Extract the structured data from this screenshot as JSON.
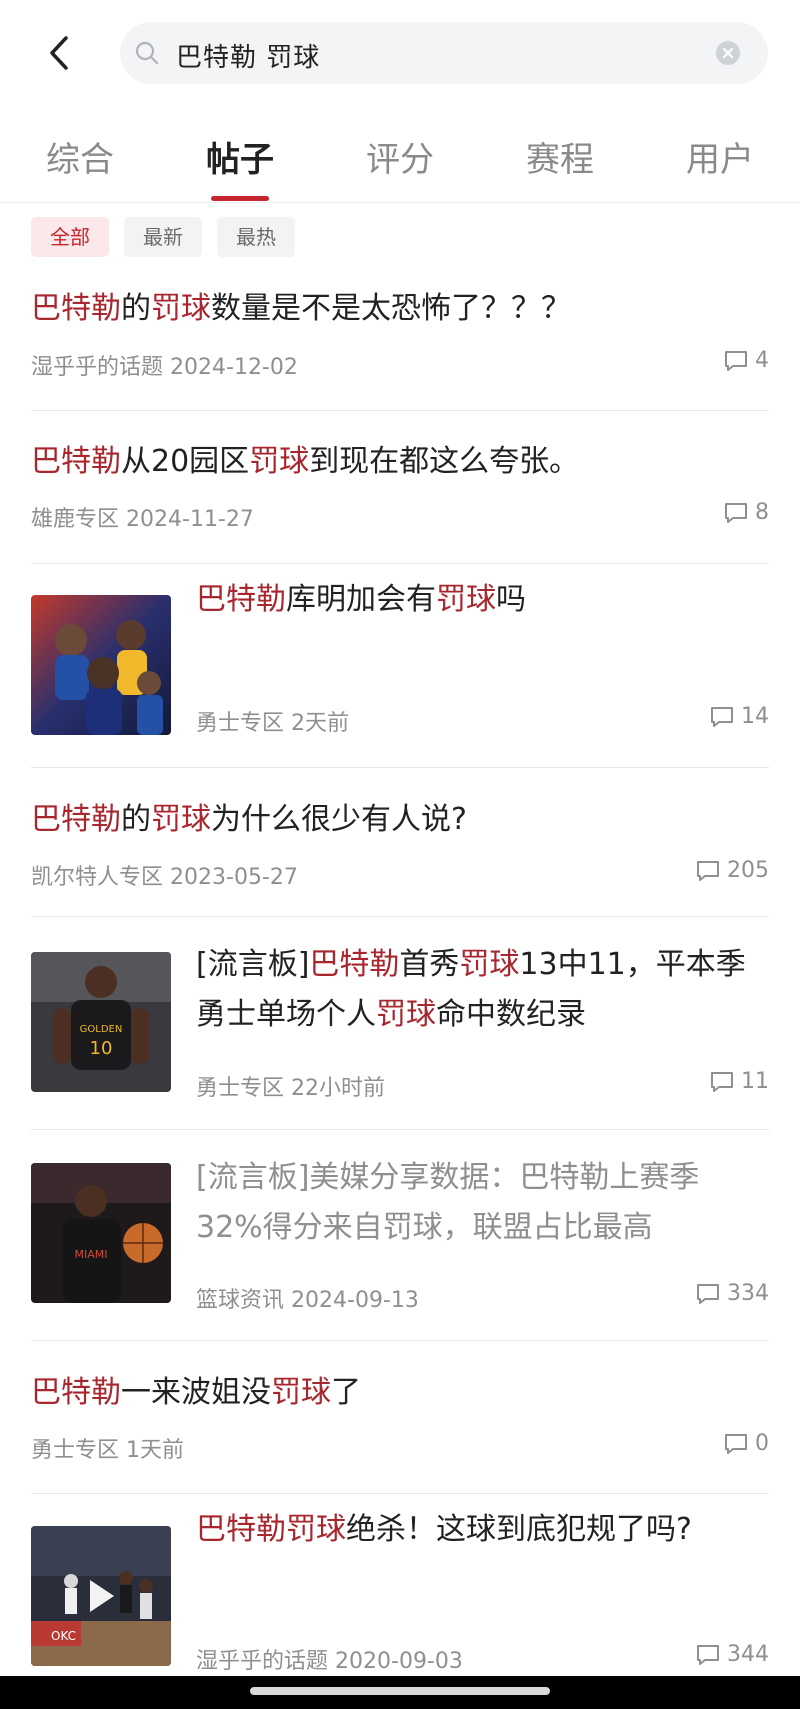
{
  "search": {
    "query": "巴特勒 罚球"
  },
  "tabs": [
    {
      "label": "综合"
    },
    {
      "label": "帖子"
    },
    {
      "label": "评分"
    },
    {
      "label": "赛程"
    },
    {
      "label": "用户"
    }
  ],
  "active_tab": "帖子",
  "filters": [
    {
      "label": "全部"
    },
    {
      "label": "最新"
    },
    {
      "label": "最热"
    }
  ],
  "active_filter": "全部",
  "posts": [
    {
      "title_parts": [
        "巴特勒",
        "的",
        "罚球",
        "数量是不是太恐怖了？？？"
      ],
      "source": "湿乎乎的话题",
      "time": "2024-12-02",
      "comments": "4"
    },
    {
      "title_parts": [
        "巴特勒",
        "从20园区",
        "罚球",
        "到现在都这么夸张。"
      ],
      "source": "雄鹿专区",
      "time": "2024-11-27",
      "comments": "8"
    },
    {
      "title_parts": [
        "巴特勒",
        "库明加会有",
        "罚球",
        "吗"
      ],
      "source": "勇士专区",
      "time": "2天前",
      "comments": "14",
      "thumbnail": "warriors-poster"
    },
    {
      "title_parts": [
        "巴特勒",
        "的",
        "罚球",
        "为什么很少有人说?"
      ],
      "source": "凯尔特人专区",
      "time": "2023-05-27",
      "comments": "205"
    },
    {
      "title_line1_parts": [
        "[流言板]",
        "巴特勒",
        "首秀",
        "罚球",
        "13中11，平本季"
      ],
      "title_line2_parts": [
        "勇士单场个人",
        "罚球",
        "命中数纪录"
      ],
      "source": "勇士专区",
      "time": "22小时前",
      "comments": "11",
      "thumbnail": "warriors-jersey-10"
    },
    {
      "title_line1": "[流言板]美媒分享数据：巴特勒上赛季",
      "title_line2": "32%得分来自罚球，联盟占比最高",
      "source": "篮球资讯",
      "time": "2024-09-13",
      "comments": "334",
      "thumbnail": "heat-player"
    },
    {
      "title_parts": [
        "巴特勒",
        "一来波姐没",
        "罚球",
        "了"
      ],
      "source": "勇士专区",
      "time": "1天前",
      "comments": "0"
    },
    {
      "title_parts": [
        "巴特勒罚球",
        "绝杀！这球到底犯规了吗?"
      ],
      "source": "湿乎乎的话题",
      "time": "2020-09-03",
      "comments": "344",
      "thumbnail": "game-video"
    }
  ]
}
